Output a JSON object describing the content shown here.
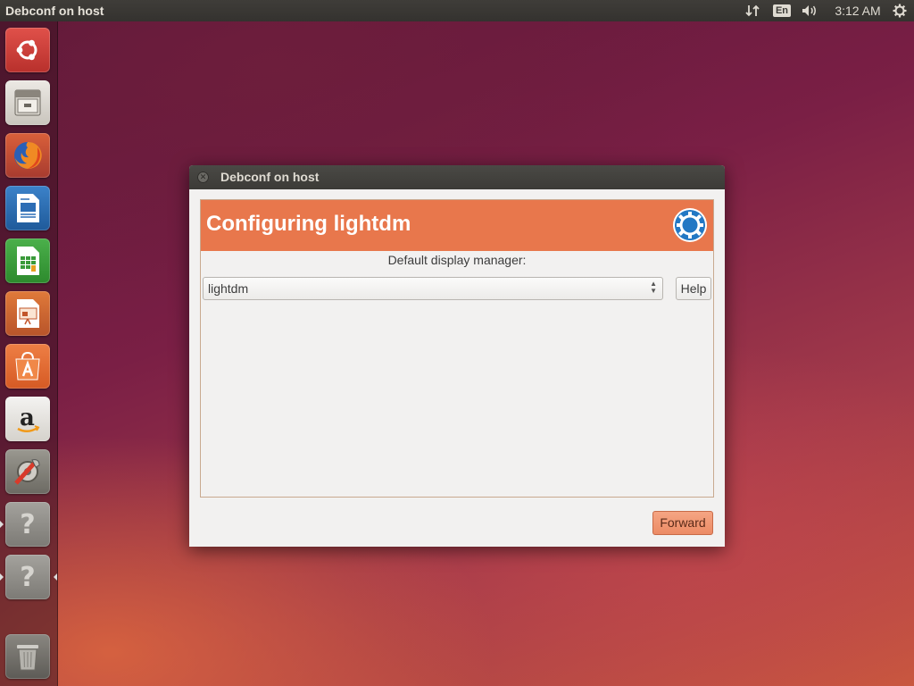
{
  "top_panel": {
    "window_title": "Debconf on host",
    "keyboard_layout": "En",
    "clock": "3:12 AM",
    "icons": [
      "network-transfer-icon",
      "keyboard-layout-indicator",
      "volume-icon",
      "system-gear-icon"
    ]
  },
  "launcher": {
    "items": [
      {
        "name": "dash",
        "icon": "ubuntu-logo-icon"
      },
      {
        "name": "files",
        "icon": "file-cabinet-icon"
      },
      {
        "name": "firefox",
        "icon": "firefox-icon"
      },
      {
        "name": "writer",
        "icon": "libreoffice-writer-icon"
      },
      {
        "name": "calc",
        "icon": "libreoffice-calc-icon"
      },
      {
        "name": "impress",
        "icon": "libreoffice-impress-icon"
      },
      {
        "name": "software",
        "icon": "software-center-icon"
      },
      {
        "name": "amazon",
        "icon": "amazon-icon"
      },
      {
        "name": "system-settings",
        "icon": "settings-tools-icon"
      },
      {
        "name": "unknown-1",
        "icon": "question-mark-icon"
      },
      {
        "name": "unknown-2",
        "icon": "question-mark-icon"
      },
      {
        "name": "trash",
        "icon": "trash-icon"
      }
    ]
  },
  "dialog": {
    "title": "Debconf on host",
    "banner_title": "Configuring lightdm",
    "question": "Default display manager:",
    "selected_value": "lightdm",
    "help_label": "Help",
    "forward_label": "Forward"
  },
  "colors": {
    "banner": "#e8774c",
    "panel": "#3c3b37",
    "accent_button": "#ec8b65"
  }
}
